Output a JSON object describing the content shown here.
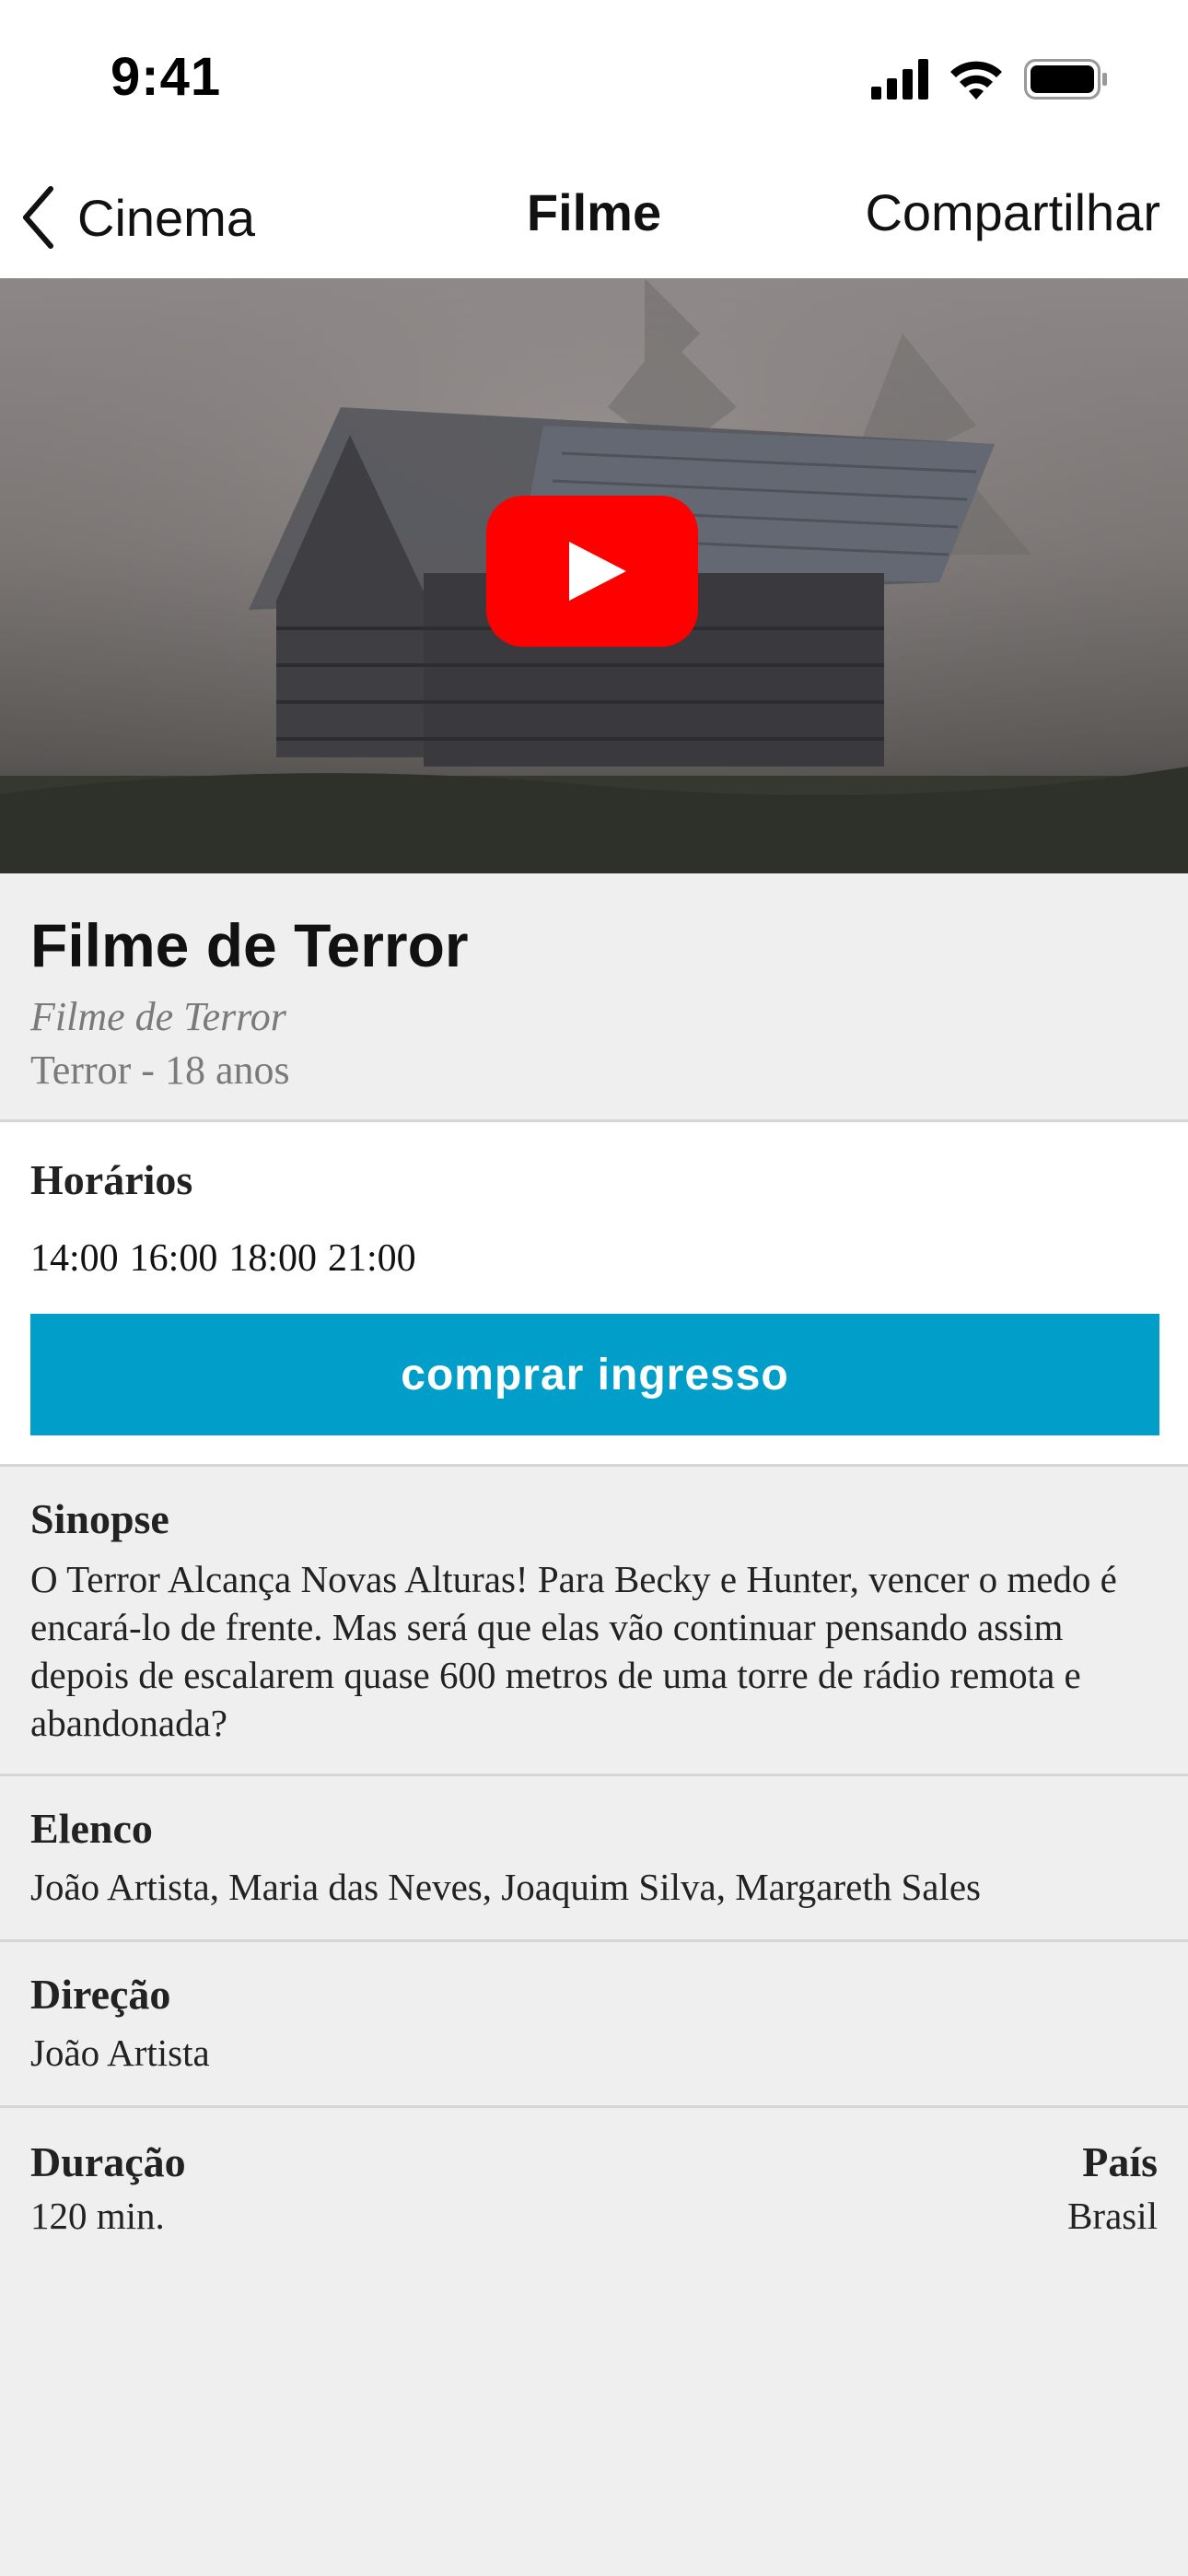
{
  "status_bar": {
    "time": "9:41",
    "icons": [
      "signal-icon",
      "wifi-icon",
      "battery-icon"
    ]
  },
  "nav": {
    "back_label": "Cinema",
    "title": "Filme",
    "share_label": "Compartilhar"
  },
  "hero": {
    "video_icon": "youtube-play-icon",
    "play_color": "#ff0000"
  },
  "movie": {
    "title": "Filme de Terror",
    "original_title": "Filme de Terror",
    "genre_rating": "Terror - 18 anos"
  },
  "showtimes": {
    "heading": "Horários",
    "times": [
      "14:00",
      "16:00",
      "18:00",
      "21:00"
    ],
    "buy_label": "comprar ingresso",
    "buy_color": "#009ec8"
  },
  "synopsis": {
    "heading": "Sinopse",
    "text": "O Terror Alcança Novas Alturas! Para Becky e Hunter, vencer o medo é encará-lo de frente. Mas será que elas vão continuar pensando assim depois de escalarem quase 600 metros de uma torre de rádio remota e abandonada?"
  },
  "cast": {
    "heading": "Elenco",
    "text": "João Artista, Maria das Neves, Joaquim Silva, Margareth Sales"
  },
  "direction": {
    "heading": "Direção",
    "text": "João Artista"
  },
  "details": {
    "duration_label": "Duração",
    "duration_value": "120 min.",
    "country_label": "País",
    "country_value": "Brasil"
  }
}
